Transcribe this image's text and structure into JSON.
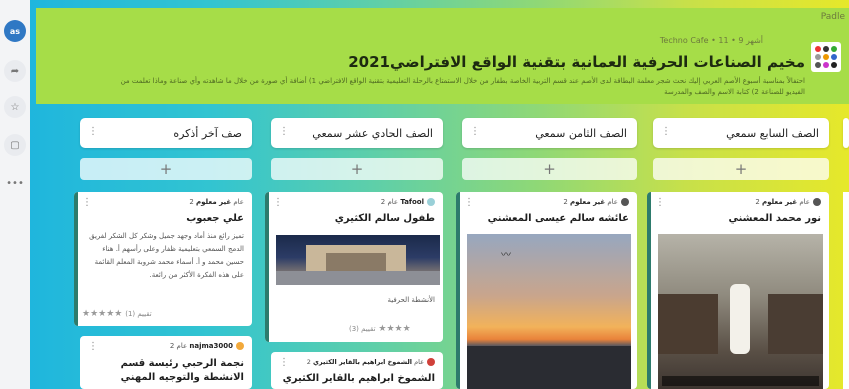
{
  "sidebar": {
    "avatar": "as"
  },
  "header": {
    "brand": "Padle",
    "meta": "Techno Cafe • 11 • 9 أشهر",
    "title": "مخيم الصناعات الحرفية العمانية بتقنية الواقع الافتراضي2021",
    "description": "احتفالاً بمناسبة أسبوع الأصم العربي إليك نحث شجر معلمة البطاقة لدى الأصم عند قسم التربية الخاصة بطفار من خلال الاستمتاع بالرحلة التعليمية بتقنية الواقع الافتراضي 1) أضافة أي صورة من خلال ما شاهدته وأي صناعة وماذا تعلمت من الفيديو للصناعة 2) كتابة الاسم والصف والمدرسة"
  },
  "columns": [
    {
      "title": "صف آخر أذكره"
    },
    {
      "title": "الصف الحادي عشر سمعي"
    },
    {
      "title": "الصف الثامن سمعي"
    },
    {
      "title": "الصف السابع سمعي"
    }
  ],
  "add_label": "+",
  "cards": {
    "c1": {
      "author": "غير معلوم",
      "time": "2 عام",
      "title": "علي جعبوب",
      "body": "تميز رائع منذ أماد وجهد جميل وشكر كل الشكر لفريق الدمج السمعي بتعليمية ظفار وعلى رأسهم أ. هناء حسين محمد و أ. أسماء محمد شروبة المعلم القائمة على هذه الفكرة الأكثر من رائعة.",
      "rating": "★★★★★",
      "count": "(1) تقييم"
    },
    "c2": {
      "author": "najma3000",
      "time": "2 عام",
      "title": "نجمة الرحبي رئيسة قسم الانشطة والتوجيه المهني"
    },
    "c3": {
      "author": "Tafool",
      "time": "2 عام",
      "title": "طفول سالم الكثيري",
      "caption": "الأنشطة الحرفية",
      "rating": "★★★★",
      "count": "(3) تقييم"
    },
    "c4": {
      "author": "الشموخ ابراهيم بالقاير الكثيري",
      "time": "2 عام",
      "title": "الشموخ ابراهيم بالقاير الكثيري"
    },
    "c5": {
      "author": "غير معلوم",
      "time": "2 عام",
      "title": "عائشه سالم عيسى المعشني"
    },
    "c6": {
      "author": "غير معلوم",
      "time": "2 عام",
      "title": "نور محمد المعشني"
    }
  }
}
